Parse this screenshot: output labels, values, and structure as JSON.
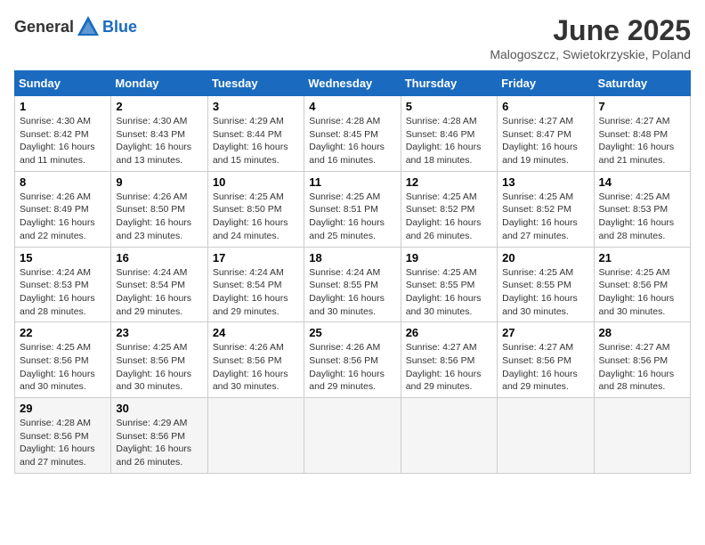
{
  "header": {
    "logo_general": "General",
    "logo_blue": "Blue",
    "month_title": "June 2025",
    "subtitle": "Malogoszcz, Swietokrzyskie, Poland"
  },
  "weekdays": [
    "Sunday",
    "Monday",
    "Tuesday",
    "Wednesday",
    "Thursday",
    "Friday",
    "Saturday"
  ],
  "weeks": [
    [
      {
        "day": "1",
        "info": "Sunrise: 4:30 AM\nSunset: 8:42 PM\nDaylight: 16 hours\nand 11 minutes."
      },
      {
        "day": "2",
        "info": "Sunrise: 4:30 AM\nSunset: 8:43 PM\nDaylight: 16 hours\nand 13 minutes."
      },
      {
        "day": "3",
        "info": "Sunrise: 4:29 AM\nSunset: 8:44 PM\nDaylight: 16 hours\nand 15 minutes."
      },
      {
        "day": "4",
        "info": "Sunrise: 4:28 AM\nSunset: 8:45 PM\nDaylight: 16 hours\nand 16 minutes."
      },
      {
        "day": "5",
        "info": "Sunrise: 4:28 AM\nSunset: 8:46 PM\nDaylight: 16 hours\nand 18 minutes."
      },
      {
        "day": "6",
        "info": "Sunrise: 4:27 AM\nSunset: 8:47 PM\nDaylight: 16 hours\nand 19 minutes."
      },
      {
        "day": "7",
        "info": "Sunrise: 4:27 AM\nSunset: 8:48 PM\nDaylight: 16 hours\nand 21 minutes."
      }
    ],
    [
      {
        "day": "8",
        "info": "Sunrise: 4:26 AM\nSunset: 8:49 PM\nDaylight: 16 hours\nand 22 minutes."
      },
      {
        "day": "9",
        "info": "Sunrise: 4:26 AM\nSunset: 8:50 PM\nDaylight: 16 hours\nand 23 minutes."
      },
      {
        "day": "10",
        "info": "Sunrise: 4:25 AM\nSunset: 8:50 PM\nDaylight: 16 hours\nand 24 minutes."
      },
      {
        "day": "11",
        "info": "Sunrise: 4:25 AM\nSunset: 8:51 PM\nDaylight: 16 hours\nand 25 minutes."
      },
      {
        "day": "12",
        "info": "Sunrise: 4:25 AM\nSunset: 8:52 PM\nDaylight: 16 hours\nand 26 minutes."
      },
      {
        "day": "13",
        "info": "Sunrise: 4:25 AM\nSunset: 8:52 PM\nDaylight: 16 hours\nand 27 minutes."
      },
      {
        "day": "14",
        "info": "Sunrise: 4:25 AM\nSunset: 8:53 PM\nDaylight: 16 hours\nand 28 minutes."
      }
    ],
    [
      {
        "day": "15",
        "info": "Sunrise: 4:24 AM\nSunset: 8:53 PM\nDaylight: 16 hours\nand 28 minutes."
      },
      {
        "day": "16",
        "info": "Sunrise: 4:24 AM\nSunset: 8:54 PM\nDaylight: 16 hours\nand 29 minutes."
      },
      {
        "day": "17",
        "info": "Sunrise: 4:24 AM\nSunset: 8:54 PM\nDaylight: 16 hours\nand 29 minutes."
      },
      {
        "day": "18",
        "info": "Sunrise: 4:24 AM\nSunset: 8:55 PM\nDaylight: 16 hours\nand 30 minutes."
      },
      {
        "day": "19",
        "info": "Sunrise: 4:25 AM\nSunset: 8:55 PM\nDaylight: 16 hours\nand 30 minutes."
      },
      {
        "day": "20",
        "info": "Sunrise: 4:25 AM\nSunset: 8:55 PM\nDaylight: 16 hours\nand 30 minutes."
      },
      {
        "day": "21",
        "info": "Sunrise: 4:25 AM\nSunset: 8:56 PM\nDaylight: 16 hours\nand 30 minutes."
      }
    ],
    [
      {
        "day": "22",
        "info": "Sunrise: 4:25 AM\nSunset: 8:56 PM\nDaylight: 16 hours\nand 30 minutes."
      },
      {
        "day": "23",
        "info": "Sunrise: 4:25 AM\nSunset: 8:56 PM\nDaylight: 16 hours\nand 30 minutes."
      },
      {
        "day": "24",
        "info": "Sunrise: 4:26 AM\nSunset: 8:56 PM\nDaylight: 16 hours\nand 30 minutes."
      },
      {
        "day": "25",
        "info": "Sunrise: 4:26 AM\nSunset: 8:56 PM\nDaylight: 16 hours\nand 29 minutes."
      },
      {
        "day": "26",
        "info": "Sunrise: 4:27 AM\nSunset: 8:56 PM\nDaylight: 16 hours\nand 29 minutes."
      },
      {
        "day": "27",
        "info": "Sunrise: 4:27 AM\nSunset: 8:56 PM\nDaylight: 16 hours\nand 29 minutes."
      },
      {
        "day": "28",
        "info": "Sunrise: 4:27 AM\nSunset: 8:56 PM\nDaylight: 16 hours\nand 28 minutes."
      }
    ],
    [
      {
        "day": "29",
        "info": "Sunrise: 4:28 AM\nSunset: 8:56 PM\nDaylight: 16 hours\nand 27 minutes."
      },
      {
        "day": "30",
        "info": "Sunrise: 4:29 AM\nSunset: 8:56 PM\nDaylight: 16 hours\nand 26 minutes."
      },
      {
        "day": "",
        "info": ""
      },
      {
        "day": "",
        "info": ""
      },
      {
        "day": "",
        "info": ""
      },
      {
        "day": "",
        "info": ""
      },
      {
        "day": "",
        "info": ""
      }
    ]
  ]
}
